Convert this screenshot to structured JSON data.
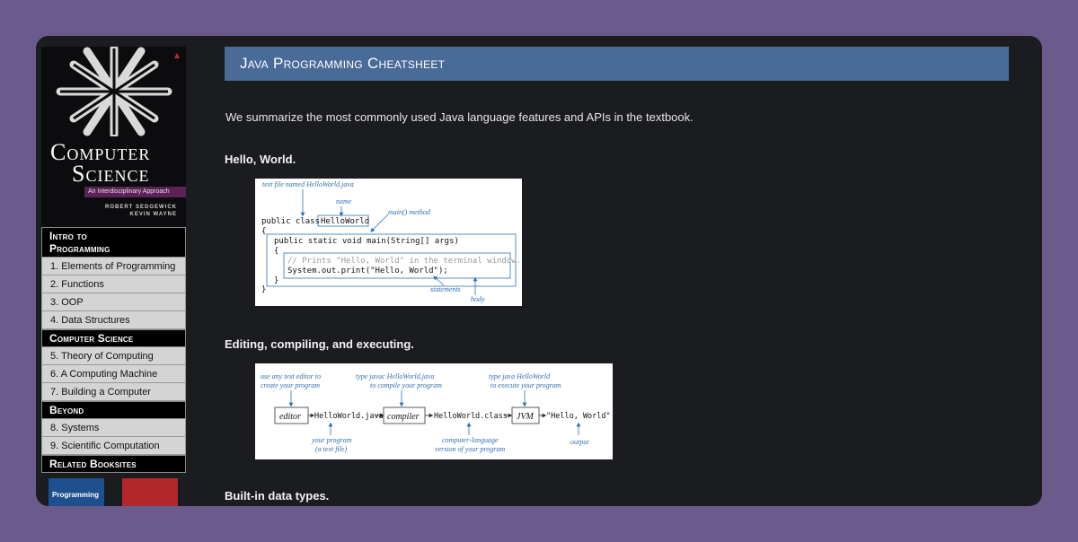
{
  "cover": {
    "title_line1": "Computer",
    "title_line2": "Science",
    "subtitle": "An Interdisciplinary Approach",
    "author1": "ROBERT SEDGEWICK",
    "author2": "KEVIN WAYNE"
  },
  "sidebar": {
    "sections": [
      {
        "title_line1": "Intro to",
        "title_line2": "Programming",
        "items": [
          "1.  Elements of Programming",
          "2.  Functions",
          "3.  OOP",
          "4.  Data Structures"
        ]
      },
      {
        "title": "Computer Science",
        "items": [
          "5.  Theory of Computing",
          "6.  A Computing Machine",
          "7.  Building a Computer"
        ]
      },
      {
        "title": "Beyond",
        "items": [
          "8.  Systems",
          "9.  Scientific Computation"
        ]
      },
      {
        "title": "Related Booksites",
        "items": []
      }
    ],
    "related_book_label": "Programming"
  },
  "main": {
    "title": "Java Programming Cheatsheet",
    "intro": "We summarize the most commonly used Java language features and APIs in the textbook.",
    "sections": [
      {
        "heading": "Hello, World."
      },
      {
        "heading": "Editing, compiling, and executing."
      },
      {
        "heading": "Built-in data types."
      }
    ]
  },
  "fig1": {
    "ann_file": "text file named HelloWorld.java",
    "ann_name": "name",
    "ann_main": "main() method",
    "code1": "public class ",
    "code1_box": "HelloWorld",
    "code2": "{",
    "code3": "public static void main(String[] args)",
    "code4": "{",
    "code5": "// Prints \"Hello, World\" in the terminal window.",
    "code6": "System.out.print(\"Hello, World\");",
    "code7": "}",
    "code8": "}",
    "ann_statements": "statements",
    "ann_body": "body"
  },
  "fig2": {
    "ann1a": "use any text editor to",
    "ann1b": "create your program",
    "ann2a": "type javac HelloWorld.java",
    "ann2b": "to compile your program",
    "ann3a": "type java HelloWorld",
    "ann3b": "to execute your program",
    "box1": "editor",
    "file1": "HelloWorld.java",
    "box2": "compiler",
    "file2": "HelloWorld.class",
    "box3": "JVM",
    "output": "\"Hello, World\"",
    "ann4a": "your program",
    "ann4b": "(a text file)",
    "ann5a": "computer-language",
    "ann5b": "version of your program",
    "ann6": "output"
  },
  "colors": {
    "banner": "#4a6a98",
    "background": "#6b5b8c",
    "window": "#1b1c1f",
    "annotation": "#2f6fb3"
  }
}
